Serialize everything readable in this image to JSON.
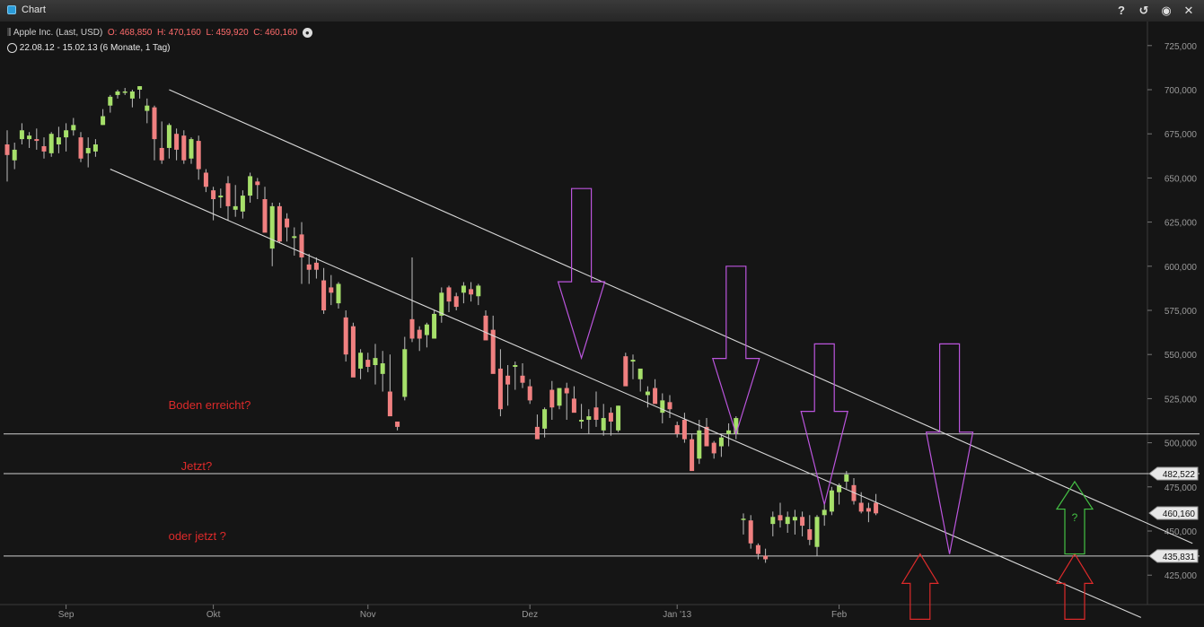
{
  "window": {
    "title": "Chart",
    "buttons": [
      {
        "name": "help-button",
        "icon": "question-icon",
        "glyph": "?"
      },
      {
        "name": "reset-button",
        "icon": "refresh-icon",
        "glyph": "↺"
      },
      {
        "name": "record-button",
        "icon": "target-icon",
        "glyph": "◉"
      },
      {
        "name": "close-button",
        "icon": "close-icon",
        "glyph": "✕"
      }
    ]
  },
  "info": {
    "instrument": "Apple Inc. (Last, USD)",
    "open": "O: 468,850",
    "high": "H: 470,160",
    "low": "L: 459,920",
    "close": "C: 460,160",
    "range": "22.08.12 - 15.02.13 (6 Monate, 1 Tag)"
  },
  "chart_data": {
    "type": "candlestick",
    "title": "",
    "xlabel": "",
    "ylabel": "",
    "ylim": [
      405000,
      737000
    ],
    "grid": false,
    "colors": {
      "up": "#a6e06a",
      "down": "#f08080",
      "annotation_red": "#dd2a2a",
      "arrow_purple": "#bb55dd",
      "arrow_green": "#44c044",
      "line": "#d8d8d8"
    },
    "y_ticks": [
      "725,000",
      "700,000",
      "675,000",
      "650,000",
      "625,000",
      "600,000",
      "575,000",
      "550,000",
      "525,000",
      "500,000",
      "475,000",
      "450,000",
      "425,000"
    ],
    "y_tick_values": [
      725000,
      700000,
      675000,
      650000,
      625000,
      600000,
      575000,
      550000,
      525000,
      500000,
      475000,
      450000,
      425000
    ],
    "x_ticks": [
      {
        "label": "Sep",
        "index": 8
      },
      {
        "label": "Okt",
        "index": 28
      },
      {
        "label": "Nov",
        "index": 49
      },
      {
        "label": "Dez",
        "index": 71
      },
      {
        "label": "Jan '13",
        "index": 91
      },
      {
        "label": "Feb",
        "index": 113
      }
    ],
    "candles": [
      [
        669,
        677,
        648,
        663
      ],
      [
        660,
        670,
        655,
        666
      ],
      [
        672,
        681,
        669,
        677
      ],
      [
        672,
        676,
        667,
        674
      ],
      [
        672,
        678,
        666,
        671
      ],
      [
        668,
        673,
        661,
        665
      ],
      [
        664,
        676,
        662,
        675
      ],
      [
        669,
        679,
        664,
        673
      ],
      [
        673,
        681,
        665,
        677
      ],
      [
        677,
        684,
        674,
        680
      ],
      [
        673,
        676,
        659,
        661
      ],
      [
        664,
        673,
        656,
        667
      ],
      [
        665,
        672,
        662,
        669
      ],
      [
        680,
        689,
        680,
        685
      ],
      [
        691,
        697,
        687,
        696
      ],
      [
        697,
        700,
        695,
        699
      ],
      [
        699,
        701,
        697,
        699
      ],
      [
        695,
        700,
        690,
        699
      ],
      [
        700,
        702,
        695,
        702
      ],
      [
        688,
        695,
        681,
        691
      ],
      [
        690,
        691,
        660,
        672
      ],
      [
        667,
        682,
        658,
        660
      ],
      [
        667,
        681,
        661,
        680
      ],
      [
        675,
        678,
        660,
        666
      ],
      [
        674,
        677,
        658,
        660
      ],
      [
        661,
        673,
        658,
        672
      ],
      [
        671,
        674,
        649,
        655
      ],
      [
        653,
        655,
        642,
        645
      ],
      [
        643,
        645,
        626,
        638
      ],
      [
        639,
        644,
        633,
        640
      ],
      [
        647,
        651,
        626,
        634
      ],
      [
        632,
        646,
        628,
        634
      ],
      [
        631,
        643,
        627,
        640
      ],
      [
        640,
        653,
        636,
        651
      ],
      [
        648,
        650,
        638,
        646
      ],
      [
        638,
        645,
        620,
        619
      ],
      [
        610,
        636,
        600,
        634
      ],
      [
        634,
        636,
        613,
        614
      ],
      [
        627,
        630,
        614,
        622
      ],
      [
        616,
        622,
        606,
        617
      ],
      [
        618,
        625,
        590,
        605
      ],
      [
        601,
        607,
        590,
        598
      ],
      [
        602,
        605,
        593,
        598
      ],
      [
        592,
        599,
        573,
        575
      ],
      [
        588,
        595,
        578,
        585
      ],
      [
        579,
        591,
        576,
        590
      ],
      [
        571,
        575,
        546,
        550
      ],
      [
        566,
        568,
        548,
        537
      ],
      [
        542,
        553,
        536,
        551
      ],
      [
        547,
        551,
        540,
        543
      ],
      [
        544,
        556,
        533,
        548
      ],
      [
        539,
        552,
        529,
        545
      ],
      [
        529,
        550,
        522,
        515
      ],
      [
        512,
        512,
        507,
        509
      ],
      [
        526,
        560,
        524,
        553
      ],
      [
        570,
        605,
        557,
        559
      ],
      [
        564,
        566,
        552,
        559
      ],
      [
        561,
        568,
        554,
        567
      ],
      [
        559,
        575,
        559,
        573
      ],
      [
        572,
        588,
        568,
        585
      ],
      [
        588,
        589,
        574,
        580
      ],
      [
        583,
        585,
        575,
        577
      ],
      [
        585,
        591,
        579,
        589
      ],
      [
        587,
        591,
        580,
        584
      ],
      [
        583,
        590,
        578,
        589
      ],
      [
        572,
        575,
        567,
        558
      ],
      [
        564,
        572,
        560,
        539
      ],
      [
        542,
        553,
        515,
        519
      ],
      [
        538,
        544,
        521,
        533
      ],
      [
        543,
        546,
        530,
        544
      ],
      [
        538,
        545,
        531,
        534
      ],
      [
        532,
        536,
        522,
        524
      ],
      [
        509,
        516,
        509,
        502
      ],
      [
        508,
        520,
        503,
        519
      ],
      [
        530,
        535,
        513,
        520
      ],
      [
        521,
        530,
        519,
        531
      ],
      [
        531,
        534,
        513,
        528
      ],
      [
        525,
        532,
        522,
        517
      ],
      [
        512,
        522,
        508,
        513
      ],
      [
        513,
        519,
        505,
        515
      ],
      [
        520,
        529,
        509,
        513
      ],
      [
        507,
        522,
        504,
        514
      ],
      [
        517,
        520,
        504,
        512
      ],
      [
        507,
        521,
        506,
        521
      ],
      [
        549,
        551,
        537,
        532
      ],
      [
        546,
        550,
        536,
        547
      ],
      [
        536,
        538,
        529,
        542
      ],
      [
        527,
        532,
        520,
        529
      ],
      [
        531,
        536,
        525,
        522
      ],
      [
        517,
        528,
        511,
        524
      ],
      [
        523,
        527,
        514,
        519
      ],
      [
        510,
        512,
        503,
        505
      ],
      [
        513,
        517,
        500,
        502
      ],
      [
        502,
        505,
        485,
        484
      ],
      [
        491,
        513,
        488,
        507
      ],
      [
        509,
        514,
        504,
        498
      ],
      [
        500,
        501,
        491,
        494
      ],
      [
        498,
        505,
        492,
        503
      ],
      [
        505,
        511,
        498,
        507
      ],
      [
        505,
        515,
        502,
        514
      ],
      [
        457,
        460,
        448,
        457
      ],
      [
        456,
        459,
        440,
        443
      ],
      [
        442,
        443,
        434,
        437
      ],
      [
        436,
        440,
        432,
        434
      ],
      [
        454,
        461,
        447,
        458
      ],
      [
        459,
        466,
        452,
        456
      ],
      [
        454,
        461,
        449,
        458
      ],
      [
        456,
        462,
        448,
        458
      ],
      [
        458,
        461,
        447,
        453
      ],
      [
        451,
        459,
        442,
        445
      ],
      [
        441,
        459,
        436,
        458
      ],
      [
        459,
        465,
        453,
        462
      ],
      [
        461,
        475,
        459,
        473
      ],
      [
        472,
        477,
        465,
        476
      ],
      [
        478,
        484,
        474,
        482
      ],
      [
        476,
        480,
        465,
        467
      ],
      [
        466,
        472,
        460,
        461
      ],
      [
        463,
        466,
        455,
        461
      ],
      [
        466,
        471,
        459,
        460
      ]
    ],
    "horizontal_lines": [
      {
        "value": 505000,
        "label": ""
      },
      {
        "value": 482522,
        "label": "482,522"
      },
      {
        "value": 435831,
        "label": "435,831"
      }
    ],
    "last_price_label": {
      "value": 460160,
      "label": "460,160"
    },
    "trend_channel": [
      {
        "name": "upper",
        "start": {
          "index": 22,
          "value": 700000
        },
        "end": {
          "index": 161,
          "value": 443000
        }
      },
      {
        "name": "lower",
        "start": {
          "index": 14,
          "value": 655000
        },
        "end": {
          "index": 154,
          "value": 401000
        }
      }
    ],
    "annotations": [
      {
        "text": "Boden erreicht?",
        "index": 28,
        "value": 519000
      },
      {
        "text": "Jetzt?",
        "index": 28,
        "value": 484500
      },
      {
        "text": "oder jetzt ?",
        "index": 28,
        "value": 445000
      }
    ],
    "arrows": [
      {
        "color": "purple",
        "direction": "down",
        "index": 78,
        "top": 644000,
        "tip": 548000
      },
      {
        "color": "purple",
        "direction": "down",
        "index": 99,
        "top": 600000,
        "tip": 505000
      },
      {
        "color": "purple",
        "direction": "down",
        "index": 111,
        "top": 556000,
        "tip": 465000
      },
      {
        "color": "purple",
        "direction": "down",
        "index": 128,
        "top": 556000,
        "tip": 437000
      },
      {
        "color": "red",
        "direction": "up",
        "index": 124,
        "top": 437000,
        "bottom": 400000
      },
      {
        "color": "red",
        "direction": "up",
        "index": 145,
        "top": 437000,
        "bottom": 400000
      },
      {
        "color": "green",
        "direction": "up",
        "index": 145,
        "top": 478000,
        "bottom": 437000,
        "label": "?"
      }
    ]
  }
}
